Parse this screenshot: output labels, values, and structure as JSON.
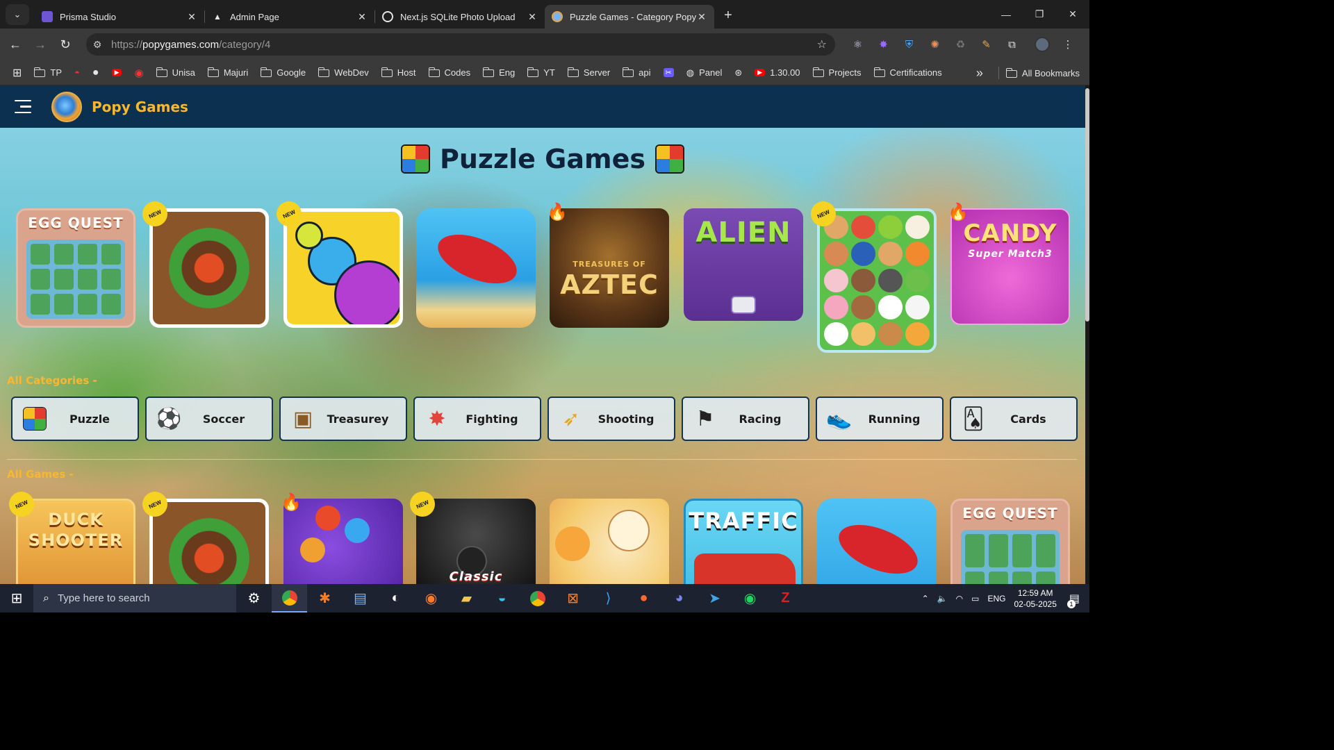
{
  "browser": {
    "tabs": [
      {
        "title": "Prisma Studio",
        "favicon_color": "#6d55d4",
        "active": false
      },
      {
        "title": "Admin Page",
        "favicon_color": "#e8e8e8",
        "active": false
      },
      {
        "title": "Next.js SQLite Photo Upload",
        "favicon_color": "#e6e6e6",
        "active": false
      },
      {
        "title": "Puzzle Games - Category Popygames",
        "favicon_color": "#f2a23a",
        "active": true
      }
    ],
    "close_glyph": "✕",
    "new_tab_glyph": "+",
    "url_prefix": "https://",
    "url_host": "popygames.com",
    "url_path": "/category/4",
    "bookmarks": [
      {
        "label": "",
        "icon": "apps-grid-icon"
      },
      {
        "label": "TP",
        "icon": "folder-icon"
      },
      {
        "label": "",
        "icon": "speed-icon"
      },
      {
        "label": "",
        "icon": "github-icon"
      },
      {
        "label": "",
        "icon": "youtube-icon"
      },
      {
        "label": "",
        "icon": "record-icon"
      },
      {
        "label": "Unisa",
        "icon": "folder-icon"
      },
      {
        "label": "Majuri",
        "icon": "folder-icon"
      },
      {
        "label": "Google",
        "icon": "folder-icon"
      },
      {
        "label": "WebDev",
        "icon": "folder-icon"
      },
      {
        "label": "Host",
        "icon": "folder-icon"
      },
      {
        "label": "Codes",
        "icon": "folder-icon"
      },
      {
        "label": "Eng",
        "icon": "folder-icon"
      },
      {
        "label": "YT",
        "icon": "folder-icon"
      },
      {
        "label": "Server",
        "icon": "folder-icon"
      },
      {
        "label": "api",
        "icon": "folder-icon"
      },
      {
        "label": "",
        "icon": "tools-icon"
      },
      {
        "label": "Panel",
        "icon": "globe-icon"
      },
      {
        "label": "",
        "icon": "openai-icon"
      },
      {
        "label": "1.30.00",
        "icon": "youtube-icon"
      },
      {
        "label": "Projects",
        "icon": "folder-icon"
      },
      {
        "label": "Certifications",
        "icon": "folder-icon"
      }
    ],
    "more_glyph": "»",
    "all_bookmarks": "All Bookmarks"
  },
  "site": {
    "brand": "Popy Games",
    "page_title": "Puzzle Games",
    "featured_games": [
      {
        "title": "EGG QUEST",
        "badge": "",
        "bg": "#d9a38c"
      },
      {
        "title": "",
        "badge": "NEW",
        "bg": "#6b3f22"
      },
      {
        "title": "",
        "badge": "NEW",
        "bg": "#f7d32a"
      },
      {
        "title": "",
        "badge": "",
        "bg": "#39a8e4"
      },
      {
        "title": "AZTEC",
        "subtitle": "TREASURES OF",
        "badge": "hot",
        "bg": "#4a2c16"
      },
      {
        "title": "ALIEN",
        "badge": "",
        "bg": "#6d3fa2"
      },
      {
        "title": "",
        "badge": "NEW",
        "bg": "#5cc04a"
      },
      {
        "title": "CANDY",
        "subtitle": "Super Match3",
        "badge": "hot",
        "bg": "#d43fc6"
      }
    ],
    "categories_label": "All Categories -",
    "categories": [
      {
        "label": "Puzzle",
        "icon": "puzzle-icon"
      },
      {
        "label": "Soccer",
        "icon": "soccer-ball-icon"
      },
      {
        "label": "Treasurey",
        "icon": "treasure-chest-icon"
      },
      {
        "label": "Fighting",
        "icon": "fighting-icon"
      },
      {
        "label": "Shooting",
        "icon": "rocket-icon"
      },
      {
        "label": "Racing",
        "icon": "racing-flag-icon"
      },
      {
        "label": "Running",
        "icon": "sneaker-icon"
      },
      {
        "label": "Cards",
        "icon": "cards-icon"
      }
    ],
    "games_label": "All Games -",
    "all_games": [
      {
        "title": "DUCK SHOOTER",
        "badge": "NEW",
        "bg": "#e8a03a"
      },
      {
        "title": "",
        "badge": "NEW",
        "bg": "#6b3f22"
      },
      {
        "title": "",
        "badge": "hot",
        "bg": "#6a2fb8"
      },
      {
        "title": "Classic",
        "badge": "NEW",
        "bg": "#1b1b1b"
      },
      {
        "title": "",
        "badge": "",
        "bg": "#f4c96b"
      },
      {
        "title": "TRAFFIC",
        "badge": "",
        "bg": "#48c8e8"
      },
      {
        "title": "",
        "badge": "",
        "bg": "#39a8e4"
      },
      {
        "title": "EGG QUEST",
        "badge": "",
        "bg": "#d9a38c"
      }
    ]
  },
  "taskbar": {
    "search_placeholder": "Type here to search",
    "lang": "ENG",
    "time": "12:59 AM",
    "date": "02-05-2025",
    "notif_count": "1"
  }
}
